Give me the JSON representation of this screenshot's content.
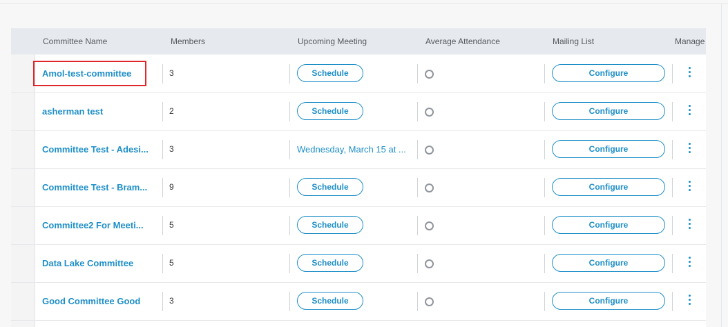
{
  "table": {
    "headers": {
      "name": "Committee Name",
      "members": "Members",
      "meeting": "Upcoming Meeting",
      "attendance": "Average Attendance",
      "mailing": "Mailing List",
      "manage": "Manage"
    },
    "rows": [
      {
        "name": "Amol-test-committee",
        "members": "3",
        "meeting": "Schedule",
        "configure": "Configure"
      },
      {
        "name": "asherman test",
        "members": "2",
        "meeting": "Schedule",
        "configure": "Configure"
      },
      {
        "name": "Committee Test - Adesi...",
        "members": "3",
        "meeting": "Wednesday, March 15 at ...",
        "configure": "Configure"
      },
      {
        "name": "Committee Test - Bram...",
        "members": "9",
        "meeting": "Schedule",
        "configure": "Configure"
      },
      {
        "name": "Committee2 For Meeti...",
        "members": "5",
        "meeting": "Schedule",
        "configure": "Configure"
      },
      {
        "name": "Data Lake Committee",
        "members": "5",
        "meeting": "Schedule",
        "configure": "Configure"
      },
      {
        "name": "Good Committee Good",
        "members": "3",
        "meeting": "Schedule",
        "configure": "Configure"
      }
    ]
  },
  "icons": {
    "attendance": "circle-outline-icon",
    "manage": "vertical-ellipsis-icon"
  },
  "colors": {
    "accent": "#1e8fc7",
    "header_bg": "#e6e9ed",
    "highlight": "#e0262a"
  }
}
